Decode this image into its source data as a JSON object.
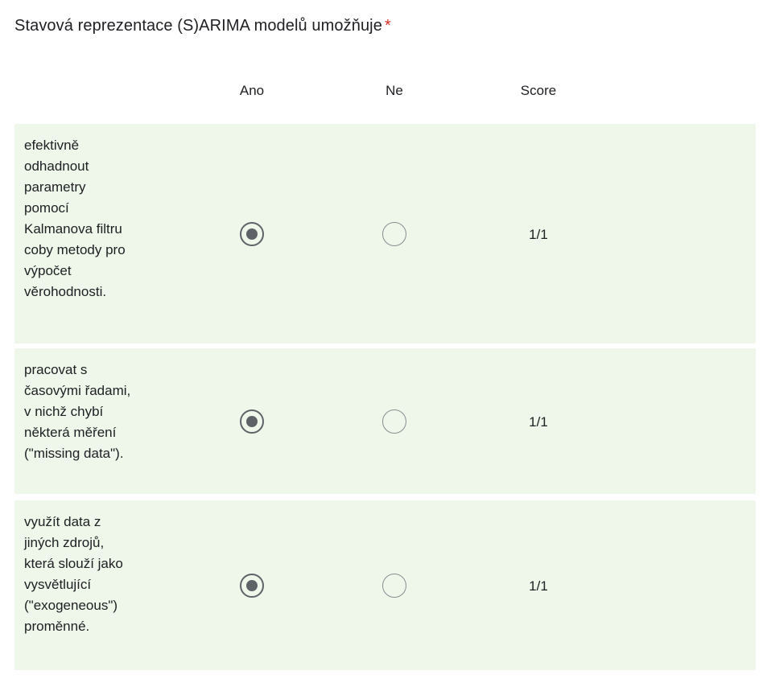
{
  "question": {
    "title": "Stavová reprezentace (S)ARIMA modelů umožňuje",
    "required_marker": "*"
  },
  "columns": {
    "ano": "Ano",
    "ne": "Ne",
    "score": "Score"
  },
  "rows": [
    {
      "label": "efektivně\nodhadnout\nparametry\npomocí\nKalmanova filtru\ncoby metody pro\nvýpočet\nvěrohodnosti.",
      "selected": "Ano",
      "score": "1/1"
    },
    {
      "label": "pracovat s\nčasovými řadami,\nv nichž chybí\nněkterá měření\n(\"missing data\").",
      "selected": "Ano",
      "score": "1/1"
    },
    {
      "label": "využít data z\njiných zdrojů,\nkterá slouží jako\nvysvětlující\n(\"exogeneous\")\nproměnné.",
      "selected": "Ano",
      "score": "1/1"
    }
  ],
  "colors": {
    "row_background": "#eff6ea",
    "required": "#d93025",
    "radio": "#5f6368"
  }
}
